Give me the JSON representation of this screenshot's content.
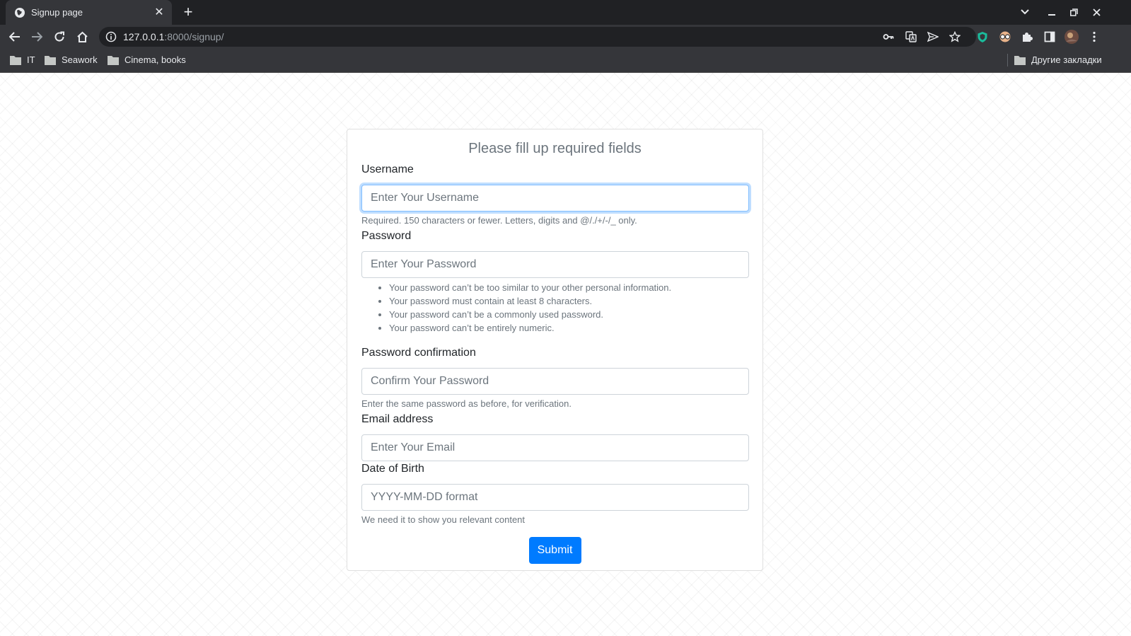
{
  "browser": {
    "tab_title": "Signup page",
    "url_host": "127.0.0.1",
    "url_rest": ":8000/signup/",
    "bookmarks": [
      "IT",
      "Seawork",
      "Cinema, books"
    ],
    "other_bookmarks": "Другие закладки"
  },
  "form": {
    "title": "Please fill up required fields",
    "username": {
      "label": "Username",
      "placeholder": "Enter Your Username",
      "help": "Required. 150 characters or fewer. Letters, digits and @/./+/-/_ only."
    },
    "password": {
      "label": "Password",
      "placeholder": "Enter Your Password",
      "rules": [
        "Your password can’t be too similar to your other personal information.",
        "Your password must contain at least 8 characters.",
        "Your password can’t be a commonly used password.",
        "Your password can’t be entirely numeric."
      ]
    },
    "password_confirmation": {
      "label": "Password confirmation",
      "placeholder": "Confirm Your Password",
      "help": "Enter the same password as before, for verification."
    },
    "email": {
      "label": "Email address",
      "placeholder": "Enter Your Email"
    },
    "dob": {
      "label": "Date of Birth",
      "placeholder": "YYYY-MM-DD format",
      "help": "We need it to show you relevant content"
    },
    "submit_label": "Submit"
  },
  "colors": {
    "primary": "#007bff",
    "focus_border": "#80bdff",
    "muted_text": "#6c757d"
  }
}
